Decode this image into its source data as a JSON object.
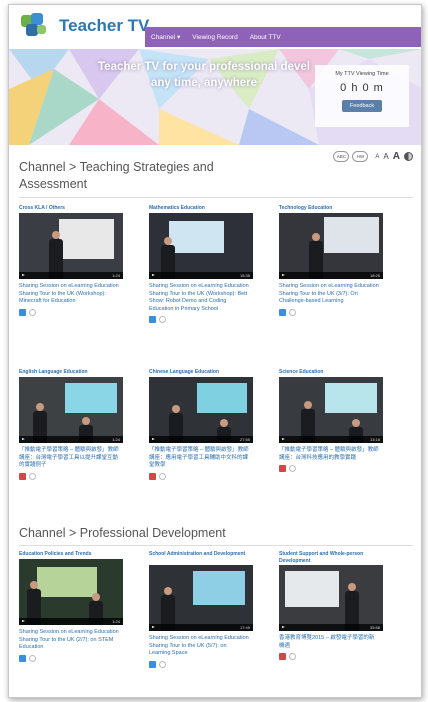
{
  "header": {
    "logo_text": "Teacher TV",
    "nav": [
      "Channel ▾",
      "Viewing Record",
      "About TTV"
    ]
  },
  "banner": {
    "tagline_line1": "Teacher TV for your professional devel",
    "tagline_line2": "any time, anywhere",
    "viewing_label": "My TTV Viewing Time",
    "viewing_time": "0 h 0 m",
    "viewing_button": "Feedback"
  },
  "tools": {
    "btn1": "ABC",
    "btn2": "HW",
    "font_a1": "A",
    "font_a2": "A",
    "font_a3": "A"
  },
  "sections": [
    {
      "title_line1": "Channel > Teaching Strategies and",
      "title_line2": "Assessment",
      "cards": [
        {
          "category": "Cross KLA / Others",
          "desc": "Sharing Session on eLearning Education Sharing Tour to the UK (Workshop): Minecraft for Education",
          "duration": "1:24",
          "lang": "en"
        },
        {
          "category": "Mathematics Education",
          "desc": "Sharing Session on eLearning Education Sharing Tour to the UK (Workshop): Bett Show: Robot Demo and Coding Education in Primary School",
          "duration": "15:35",
          "lang": "en"
        },
        {
          "category": "Technology Education",
          "desc": "Sharing Session on eLearning Education Sharing Tour to the UK (3/7): On Challenge-based Learning",
          "duration": "18:25",
          "lang": "en"
        },
        {
          "category": "English Language Education",
          "desc": "「推動電子學習策略 – 體驗與啟發」教師講座：台灣電子學習工具以提升課堂互動的實踐例子",
          "duration": "1:24",
          "lang": "zh"
        },
        {
          "category": "Chinese Language Education",
          "desc": "「推動電子學習策略 – 體驗與啟發」教師講座：應用電子學習工具輔助中文科的課堂教學",
          "duration": "27:55",
          "lang": "zh"
        },
        {
          "category": "Science Education",
          "desc": "「推動電子學習策略 – 體驗與啟發」教師講座：台灣科技應用的教學實踐",
          "duration": "13:18",
          "lang": "zh"
        }
      ]
    },
    {
      "title_line1": "Channel > Professional Development",
      "cards": [
        {
          "category": "Education Policies and Trends",
          "desc": "Sharing Session on eLearning Education Sharing Tour to the UK (2/7): on STEM Education",
          "duration": "1:24",
          "lang": "en"
        },
        {
          "category": "School Administration and Development",
          "desc": "Sharing Session on eLearning Education Sharing Tour to the UK (5/7): on Learning Space",
          "duration": "17:49",
          "lang": "en"
        },
        {
          "category": "Student Support and Whole-person Development",
          "desc": "香港教育博覽2015 – 啟發電子學習的新機遇",
          "duration": "35:58",
          "lang": "zh"
        }
      ]
    }
  ],
  "colors": {
    "accent": "#8f62b9",
    "link": "#2a6fb0",
    "title": "#555555"
  }
}
